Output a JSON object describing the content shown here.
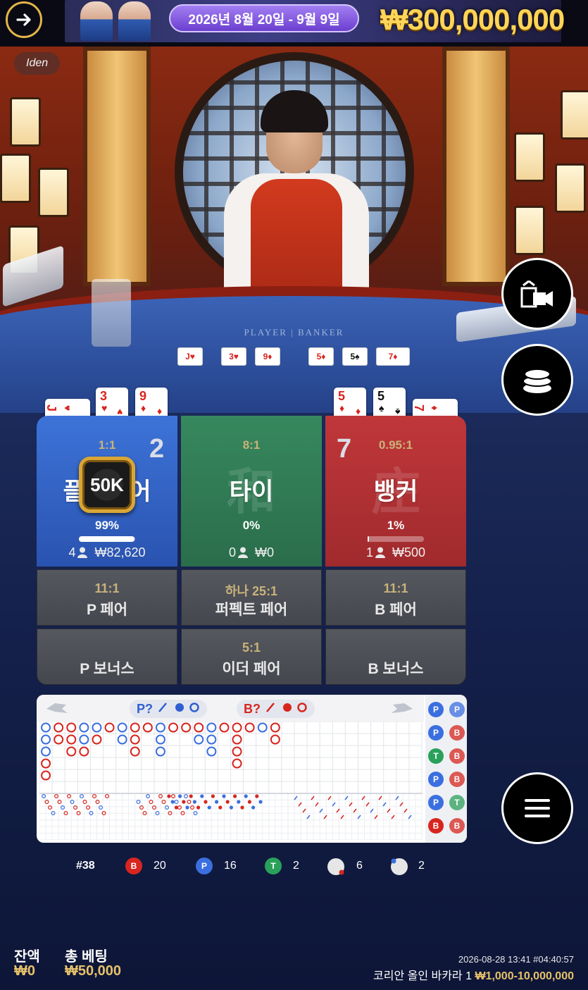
{
  "banner": {
    "date_range": "2026년 8월 20일 - 9월 9일",
    "prize": "₩300,000,000"
  },
  "stream": {
    "badge": "Iden",
    "table_label": "PLAYER | BANKER",
    "table_cards": [
      "J♥",
      "3♥",
      "9♦",
      "5♦",
      "5♠",
      "7♦"
    ]
  },
  "player_cards": [
    {
      "rank": "J",
      "suit": "♥",
      "color": "red",
      "sideways": true
    },
    {
      "rank": "3",
      "suit": "♥",
      "color": "red",
      "sideways": false
    },
    {
      "rank": "9",
      "suit": "♦",
      "color": "red",
      "sideways": false
    }
  ],
  "banker_cards": [
    {
      "rank": "5",
      "suit": "♦",
      "color": "red",
      "sideways": false
    },
    {
      "rank": "5",
      "suit": "♠",
      "color": "black",
      "sideways": false
    },
    {
      "rank": "7",
      "suit": "♦",
      "color": "red",
      "sideways": true
    }
  ],
  "bets": {
    "player": {
      "score": "2",
      "odds": "1:1",
      "name": "플레이어",
      "watermark": "閑",
      "percent": "99%",
      "percent_value": 0.99,
      "players": "4",
      "amount": "₩82,620"
    },
    "tie": {
      "odds": "8:1",
      "name": "타이",
      "watermark": "和",
      "percent": "0%",
      "percent_value": 0,
      "players": "0",
      "amount": "₩0"
    },
    "banker": {
      "score": "7",
      "odds": "0.95:1",
      "name": "뱅커",
      "watermark": "庄",
      "percent": "1%",
      "percent_value": 0.01,
      "players": "1",
      "amount": "₩500"
    },
    "chip": "50K",
    "side": [
      {
        "odds": "11:1",
        "name": "P 페어"
      },
      {
        "odds": "하나 25:1",
        "name": "퍼펙트 페어"
      },
      {
        "odds": "11:1",
        "name": "B 페어"
      },
      {
        "odds": "",
        "name": "P 보너스"
      },
      {
        "odds": "5:1",
        "name": "이더 페어"
      },
      {
        "odds": "",
        "name": "B 보너스"
      }
    ]
  },
  "roadmap": {
    "ask_player": "P?",
    "ask_banker": "B?",
    "side_col": [
      [
        "P",
        "P"
      ],
      [
        "P",
        "B"
      ],
      [
        "T",
        "B"
      ],
      [
        "P",
        "B"
      ],
      [
        "P",
        "T"
      ],
      [
        "B",
        "B"
      ]
    ]
  },
  "totals": {
    "round": "#38",
    "banker_label": "B",
    "banker_count": "20",
    "player_label": "P",
    "player_count": "16",
    "tie_label": "T",
    "tie_count": "2",
    "banker_pair_count": "6",
    "player_pair_count": "2"
  },
  "footer": {
    "balance_label": "잔액",
    "balance": "₩0",
    "total_bet_label": "총 베팅",
    "total_bet": "₩50,000",
    "timestamp": "2026-08-28 13:41 #04:40:57",
    "table_name": "코리안 올인 바카라 1",
    "limits": "₩1,000-10,000,000"
  },
  "colors": {
    "player": "#3d73d8",
    "tie": "#37885e",
    "banker": "#c0373a",
    "gold": "#e7c16a"
  },
  "icons": [
    "arrow-right-icon",
    "camera-switch-icon",
    "chips-stack-icon",
    "menu-icon",
    "person-icon"
  ]
}
